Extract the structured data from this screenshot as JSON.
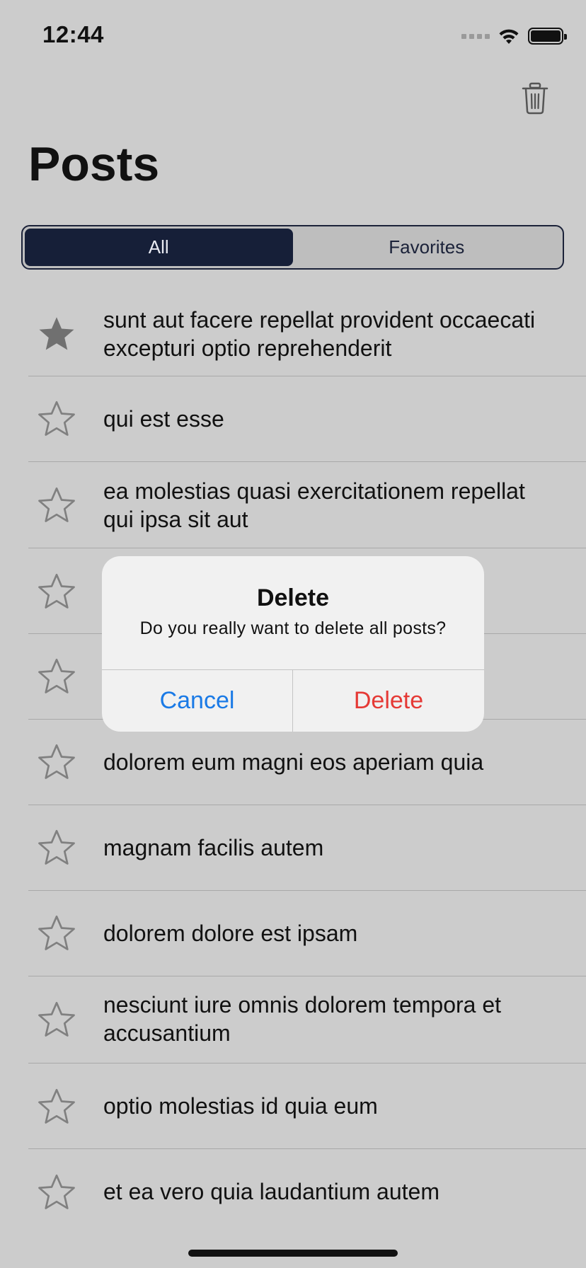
{
  "status_bar": {
    "time": "12:44",
    "icons": [
      "signal-dots-icon",
      "wifi-icon",
      "battery-icon"
    ]
  },
  "nav": {
    "title": "Posts",
    "trash_icon": "trash-icon"
  },
  "segments": [
    {
      "label": "All",
      "active": true
    },
    {
      "label": "Favorites",
      "active": false
    }
  ],
  "posts": [
    {
      "title": "sunt aut facere repellat provident occaecati excepturi optio reprehenderit",
      "favorite": true
    },
    {
      "title": "qui est esse",
      "favorite": false
    },
    {
      "title": "ea molestias quasi exercitationem repellat qui ipsa sit aut",
      "favorite": false
    },
    {
      "title": "",
      "favorite": false
    },
    {
      "title": "",
      "favorite": false
    },
    {
      "title": "dolorem eum magni eos aperiam quia",
      "favorite": false
    },
    {
      "title": "magnam facilis autem",
      "favorite": false
    },
    {
      "title": "dolorem dolore est ipsam",
      "favorite": false
    },
    {
      "title": "nesciunt iure omnis dolorem tempora et accusantium",
      "favorite": false
    },
    {
      "title": "optio molestias id quia eum",
      "favorite": false
    },
    {
      "title": "et ea vero quia laudantium autem",
      "favorite": false
    }
  ],
  "alert": {
    "title": "Delete",
    "message": "Do you really want to delete all posts?",
    "cancel_label": "Cancel",
    "delete_label": "Delete"
  },
  "colors": {
    "background": "#cccccc",
    "segment_active": "#161f38",
    "star_filled": "#707070",
    "star_outline": "#808080",
    "cancel_blue": "#1a7ae6",
    "delete_red": "#e53935"
  }
}
